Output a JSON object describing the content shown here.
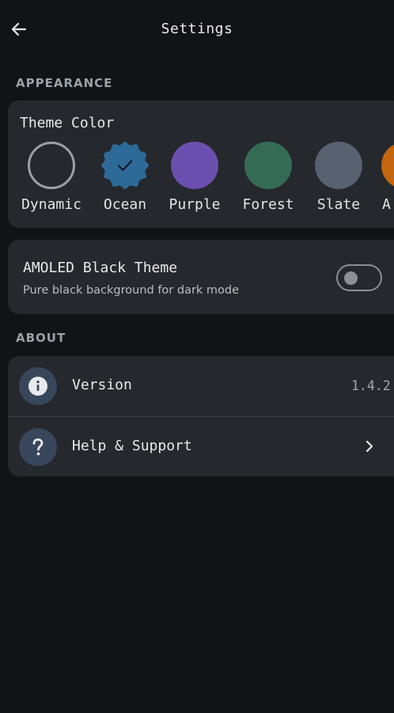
{
  "header": {
    "title": "Settings"
  },
  "sections": {
    "appearance_label": "APPEARANCE",
    "about_label": "ABOUT"
  },
  "theme": {
    "title": "Theme Color",
    "selected": "Ocean",
    "options": [
      {
        "label": "Dynamic",
        "color": "#9fcaf9"
      },
      {
        "label": "Ocean",
        "color": "#2e6a97"
      },
      {
        "label": "Purple",
        "color": "#6a4fae"
      },
      {
        "label": "Forest",
        "color": "#346b55"
      },
      {
        "label": "Slate",
        "color": "#576170"
      },
      {
        "label": "A",
        "color": "#c4650f"
      }
    ]
  },
  "amoled": {
    "title": "AMOLED Black Theme",
    "subtitle": "Pure black background for dark mode",
    "enabled": false
  },
  "about": {
    "version_label": "Version",
    "version_value": "1.4.2",
    "help_label": "Help & Support"
  },
  "icons": [
    "back-arrow-icon",
    "checkmark-icon",
    "info-icon",
    "help-icon",
    "chevron-right-icon"
  ]
}
